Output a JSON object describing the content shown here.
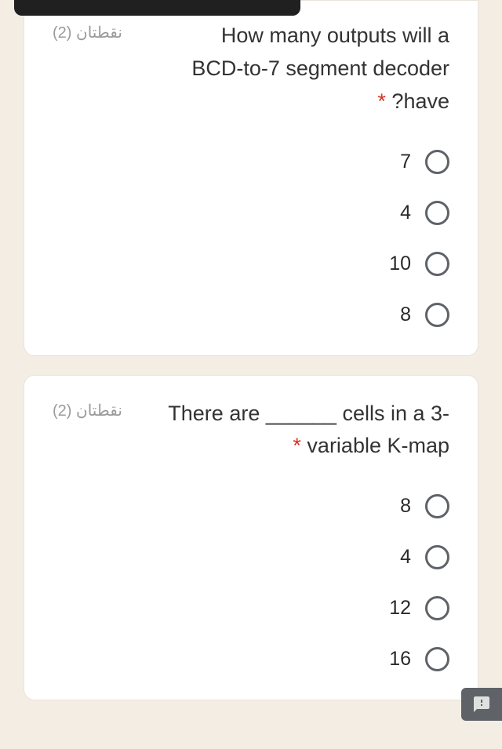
{
  "questions": [
    {
      "points": "نقطتان (2)",
      "text_line1": "How many outputs will a",
      "text_line2": "BCD-to-7 segment decoder",
      "text_line3_prefix": "?have",
      "required": "*",
      "options": [
        "7",
        "4",
        "10",
        "8"
      ]
    },
    {
      "points": "نقطتان (2)",
      "text_line1": "There are ______ cells in a 3-",
      "text_line2": "variable K-map",
      "required": "*",
      "options": [
        "8",
        "4",
        "12",
        "16"
      ]
    }
  ]
}
